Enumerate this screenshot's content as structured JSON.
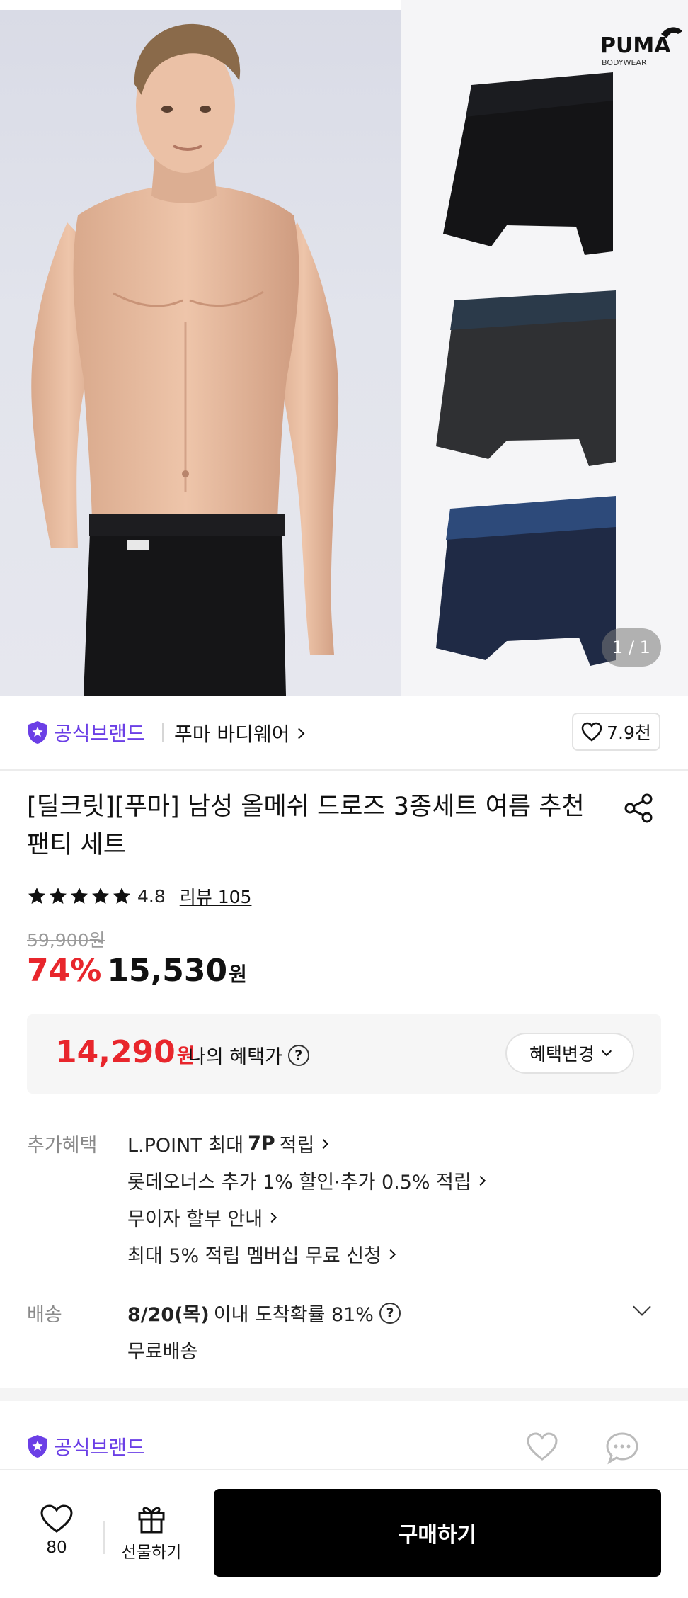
{
  "hero": {
    "page_indicator": "1 / 1",
    "brand_logo_text": "PUMA",
    "brand_logo_sub": "BODYWEAR",
    "product_colors": [
      "#141416",
      "#2f3033",
      "#1f2a45"
    ],
    "waistband_colors": [
      "#1b1c20",
      "#2b3a4a",
      "#2d4a7a"
    ]
  },
  "brand": {
    "official_label": "공식브랜드",
    "store_name": "푸마 바디웨어",
    "like_count": "7.9천"
  },
  "product": {
    "title": "[딜크릿][푸마] 남성 올메쉬 드로즈 3종세트 여름 추천 팬티 세트",
    "rating": "4.8",
    "rating_stars": 5,
    "review_link": "리뷰 105",
    "original_price": "59,900원",
    "discount": "74%",
    "sale_price": "15,530",
    "currency": "원"
  },
  "benefit": {
    "price": "14,290",
    "currency": "원",
    "label": "나의 혜택가",
    "change_button": "혜택변경"
  },
  "extra_benefits": {
    "label": "추가혜택",
    "lpoint_prefix": "L.POINT 최대",
    "lpoint_amount": "7P",
    "lpoint_suffix": "적립",
    "line2": "롯데오너스 추가 1% 할인·추가 0.5% 적립",
    "line3": "무이자 할부 안내",
    "line4": "최대 5% 적립 멤버십 무료 신청"
  },
  "shipping": {
    "label": "배송",
    "date": "8/20(목)",
    "arrival_text": "이내 도착확률 81%",
    "fee": "무료배송"
  },
  "footer_brand": {
    "official_label": "공식브랜드"
  },
  "action_bar": {
    "wish_count": "80",
    "gift_label": "선물하기",
    "buy_label": "구매하기"
  },
  "colors": {
    "accent_red": "#e8262c",
    "official_purple": "#6b3fe6",
    "buy_button": "#000000"
  }
}
